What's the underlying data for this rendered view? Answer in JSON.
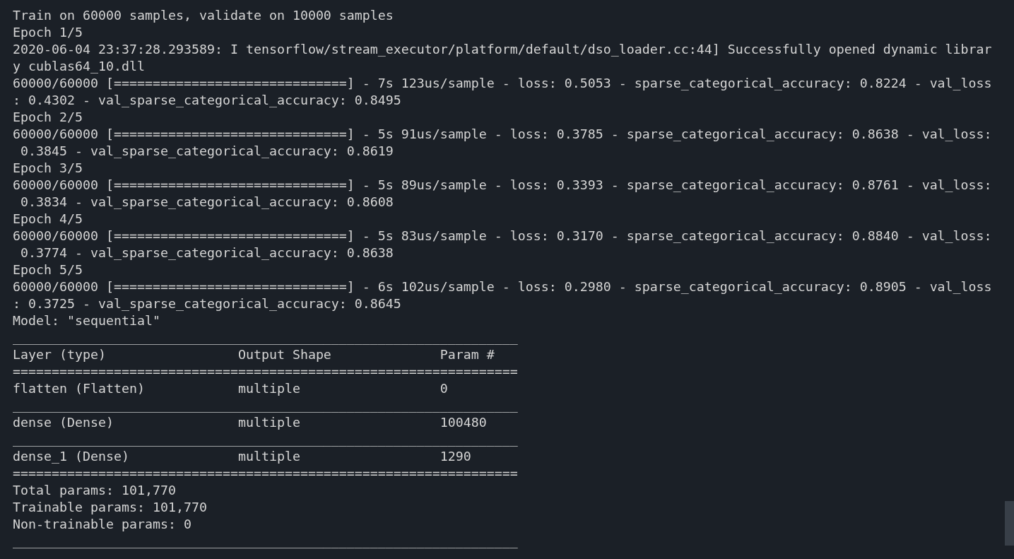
{
  "terminal": {
    "lines": [
      "Train on 60000 samples, validate on 10000 samples",
      "Epoch 1/5",
      "2020-06-04 23:37:28.293589: I tensorflow/stream_executor/platform/default/dso_loader.cc:44] Successfully opened dynamic librar",
      "y cublas64_10.dll",
      "60000/60000 [==============================] - 7s 123us/sample - loss: 0.5053 - sparse_categorical_accuracy: 0.8224 - val_loss",
      ": 0.4302 - val_sparse_categorical_accuracy: 0.8495",
      "Epoch 2/5",
      "60000/60000 [==============================] - 5s 91us/sample - loss: 0.3785 - sparse_categorical_accuracy: 0.8638 - val_loss:",
      " 0.3845 - val_sparse_categorical_accuracy: 0.8619",
      "Epoch 3/5",
      "60000/60000 [==============================] - 5s 89us/sample - loss: 0.3393 - sparse_categorical_accuracy: 0.8761 - val_loss:",
      " 0.3834 - val_sparse_categorical_accuracy: 0.8608",
      "Epoch 4/5",
      "60000/60000 [==============================] - 5s 83us/sample - loss: 0.3170 - sparse_categorical_accuracy: 0.8840 - val_loss:",
      " 0.3774 - val_sparse_categorical_accuracy: 0.8638",
      "Epoch 5/5",
      "60000/60000 [==============================] - 6s 102us/sample - loss: 0.2980 - sparse_categorical_accuracy: 0.8905 - val_loss",
      ": 0.3725 - val_sparse_categorical_accuracy: 0.8645",
      "Model: \"sequential\"",
      "_________________________________________________________________",
      "Layer (type)                 Output Shape              Param #",
      "=================================================================",
      "flatten (Flatten)            multiple                  0",
      "_________________________________________________________________",
      "dense (Dense)                multiple                  100480",
      "_________________________________________________________________",
      "dense_1 (Dense)              multiple                  1290",
      "=================================================================",
      "Total params: 101,770",
      "Trainable params: 101,770",
      "Non-trainable params: 0",
      "_________________________________________________________________"
    ]
  }
}
